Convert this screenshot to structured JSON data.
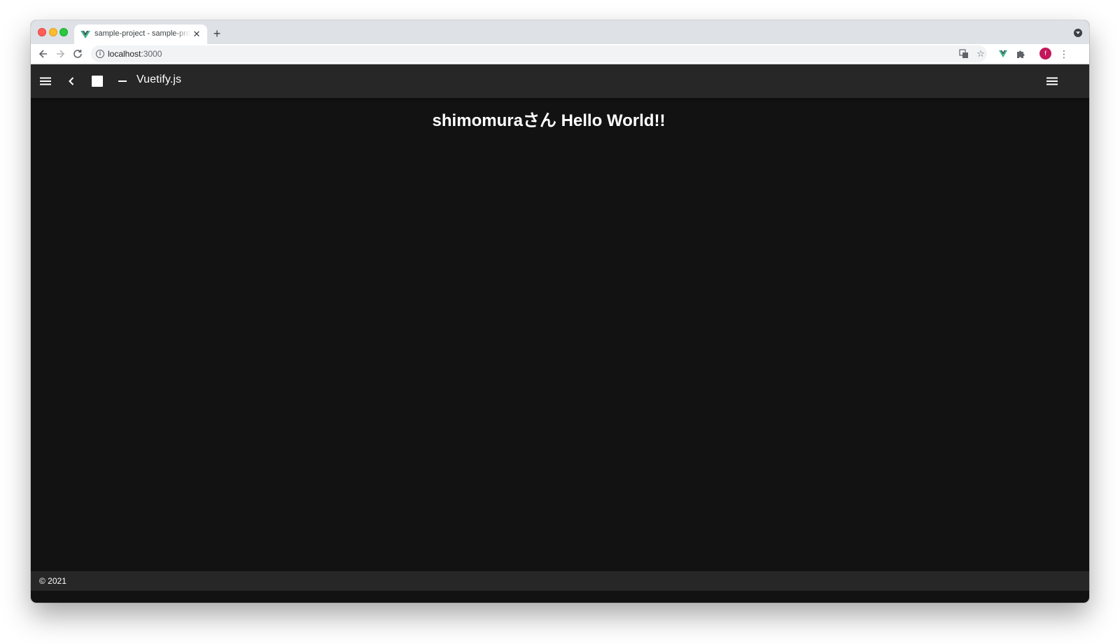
{
  "browser": {
    "tab": {
      "title": "sample-project - sample-project",
      "favicon": "vue-logo-icon"
    },
    "address_bar": {
      "host": "localhost",
      "port": ":3000"
    },
    "profile_initial": "f"
  },
  "app": {
    "title": "Vuetify.js",
    "headline": "shimomuraさん Hello World!!",
    "footer": "© 2021"
  },
  "colors": {
    "appbar": "#272727",
    "background": "#121212",
    "avatar": "#c2185b",
    "vue_green": "#41b883"
  }
}
